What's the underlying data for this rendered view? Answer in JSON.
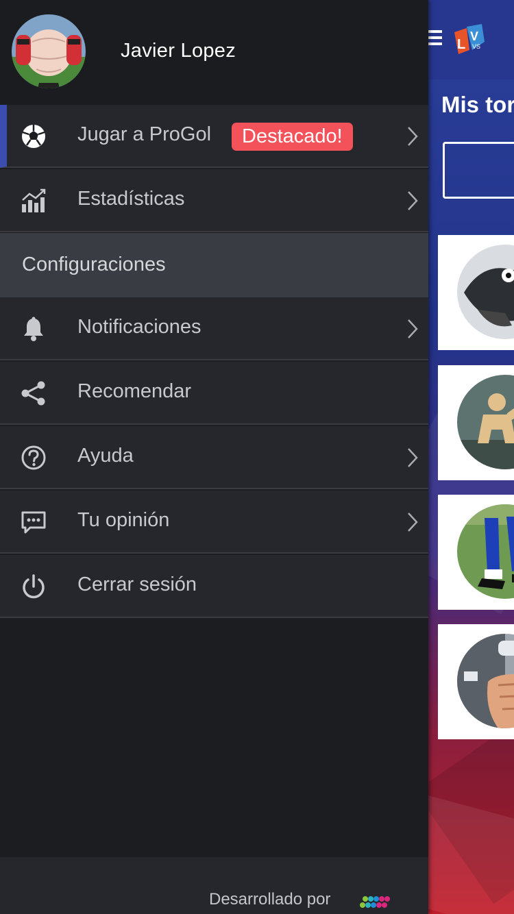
{
  "profile": {
    "user_name": "Javier Lopez"
  },
  "menu": {
    "items": [
      {
        "label": "Jugar a ProGol",
        "icon": "soccer-ball-icon",
        "badge": "Destacado!",
        "has_chevron": true,
        "active": true
      },
      {
        "label": "Estadísticas",
        "icon": "stats-chart-icon",
        "has_chevron": true
      },
      {
        "label": "Notificaciones",
        "icon": "bell-icon",
        "has_chevron": true
      },
      {
        "label": "Recomendar",
        "icon": "share-icon",
        "has_chevron": false
      },
      {
        "label": "Ayuda",
        "icon": "help-icon",
        "has_chevron": true
      },
      {
        "label": "Tu opinión",
        "icon": "feedback-icon",
        "has_chevron": true
      },
      {
        "label": "Cerrar sesión",
        "icon": "power-icon",
        "has_chevron": false
      }
    ],
    "section_header": "Configuraciones"
  },
  "footer": {
    "text": "Desarrollado por"
  },
  "background_app": {
    "title": "Mis tor"
  },
  "colors": {
    "drawer_bg": "#1c1d21",
    "row_bg": "#25272c",
    "section_bg": "#393c43",
    "active_accent": "#3b4db0",
    "badge": "#f4525a",
    "app_bar": "#27378f"
  }
}
